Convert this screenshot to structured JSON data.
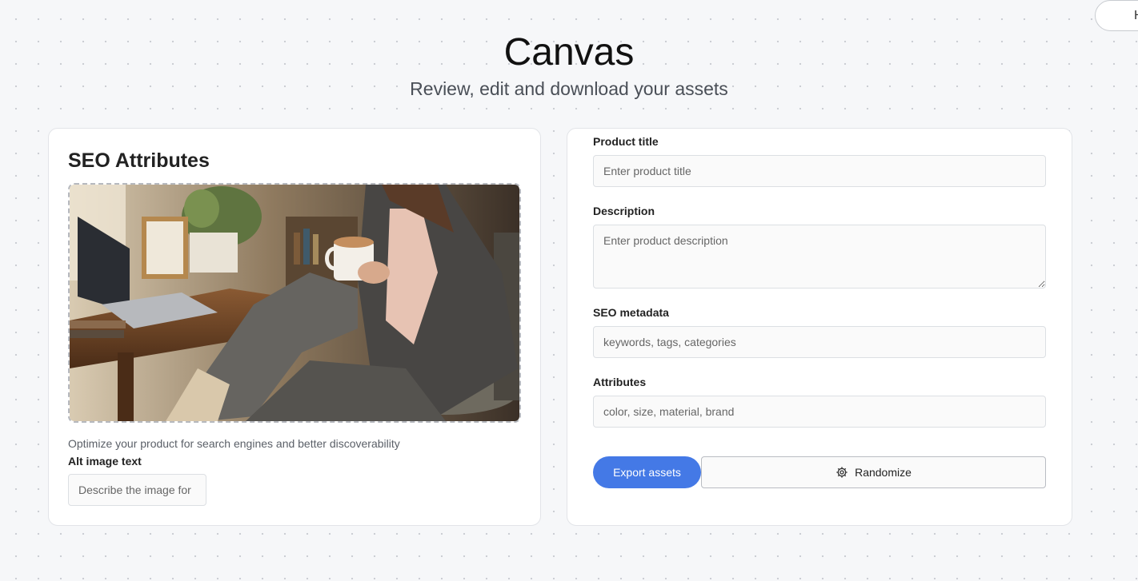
{
  "header": {
    "title": "Canvas",
    "subtitle": "Review, edit and download your assets",
    "corner_button_label": "H"
  },
  "seo_card": {
    "title": "SEO Attributes",
    "image_icon": "product-photo",
    "helper_text": "Optimize your product for search engines and better discoverability",
    "alt_label": "Alt image text",
    "alt_placeholder": "Describe the image for"
  },
  "form": {
    "product_title": {
      "label": "Product title",
      "placeholder": "Enter product title"
    },
    "description": {
      "label": "Description",
      "placeholder": "Enter product description"
    },
    "seo_metadata": {
      "label": "SEO metadata",
      "placeholder": "keywords, tags, categories"
    },
    "attributes": {
      "label": "Attributes",
      "placeholder": "color, size, material, brand"
    }
  },
  "actions": {
    "export_label": "Export assets",
    "randomize_label": "Randomize",
    "randomize_icon": "gear-icon"
  },
  "colors": {
    "accent": "#4479e6",
    "background": "#f6f7f9",
    "card": "#ffffff"
  }
}
